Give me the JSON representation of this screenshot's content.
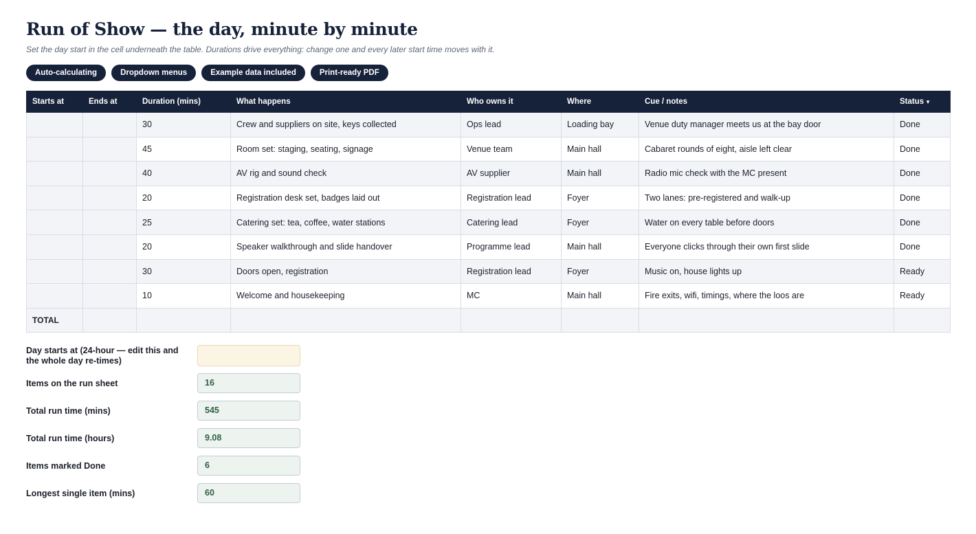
{
  "title": "Run of Show — the day, minute by minute",
  "subtitle": "Set the day start in the cell underneath the table. Durations drive everything: change one and every later start time moves with it.",
  "pills": [
    "Auto-calculating",
    "Dropdown menus",
    "Example data included",
    "Print-ready PDF"
  ],
  "table": {
    "headers": [
      "Starts at",
      "Ends at",
      "Duration (mins)",
      "What happens",
      "Who owns it",
      "Where",
      "Cue / notes",
      "Status"
    ],
    "rows": [
      {
        "start": "",
        "end": "",
        "duration": "30",
        "what": "Crew and suppliers on site, keys collected",
        "owner": "Ops lead",
        "where": "Loading bay",
        "notes": "Venue duty manager meets us at the bay door",
        "status": "Done"
      },
      {
        "start": "",
        "end": "",
        "duration": "45",
        "what": "Room set: staging, seating, signage",
        "owner": "Venue team",
        "where": "Main hall",
        "notes": "Cabaret rounds of eight, aisle left clear",
        "status": "Done"
      },
      {
        "start": "",
        "end": "",
        "duration": "40",
        "what": "AV rig and sound check",
        "owner": "AV supplier",
        "where": "Main hall",
        "notes": "Radio mic check with the MC present",
        "status": "Done"
      },
      {
        "start": "",
        "end": "",
        "duration": "20",
        "what": "Registration desk set, badges laid out",
        "owner": "Registration lead",
        "where": "Foyer",
        "notes": "Two lanes: pre-registered and walk-up",
        "status": "Done"
      },
      {
        "start": "",
        "end": "",
        "duration": "25",
        "what": "Catering set: tea, coffee, water stations",
        "owner": "Catering lead",
        "where": "Foyer",
        "notes": "Water on every table before doors",
        "status": "Done"
      },
      {
        "start": "",
        "end": "",
        "duration": "20",
        "what": "Speaker walkthrough and slide handover",
        "owner": "Programme lead",
        "where": "Main hall",
        "notes": "Everyone clicks through their own first slide",
        "status": "Done"
      },
      {
        "start": "",
        "end": "",
        "duration": "30",
        "what": "Doors open, registration",
        "owner": "Registration lead",
        "where": "Foyer",
        "notes": "Music on, house lights up",
        "status": "Ready"
      },
      {
        "start": "",
        "end": "",
        "duration": "10",
        "what": "Welcome and housekeeping",
        "owner": "MC",
        "where": "Main hall",
        "notes": "Fire exits, wifi, timings, where the loos are",
        "status": "Ready"
      }
    ],
    "total_label": "TOTAL"
  },
  "summary": {
    "day_start": {
      "label": "Day starts at (24-hour — edit this and the whole day re-times)",
      "value": ""
    },
    "items": {
      "label": "Items on the run sheet",
      "value": "16"
    },
    "run_mins": {
      "label": "Total run time (mins)",
      "value": "545"
    },
    "run_hours": {
      "label": "Total run time (hours)",
      "value": "9.08"
    },
    "done": {
      "label": "Items marked Done",
      "value": "6"
    },
    "longest": {
      "label": "Longest single item (mins)",
      "value": "60"
    }
  },
  "colors": {
    "navy": "#16213a",
    "row_alt": "#f2f4f8",
    "calc_box": "#edf3ee",
    "input_box": "#fdf5e3",
    "calc_text": "#2e6248"
  }
}
